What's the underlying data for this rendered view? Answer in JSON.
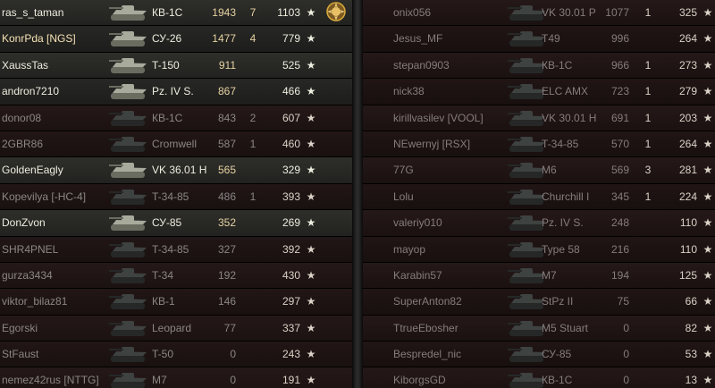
{
  "left_team": [
    {
      "player": "ras_s_taman",
      "tank": "КВ-1С",
      "damage": "1943",
      "kills": "7",
      "xp": "1103",
      "alive": true,
      "medal": true
    },
    {
      "player": "KonrPda [NGS]",
      "tank": "СУ-26",
      "damage": "1477",
      "kills": "4",
      "xp": "779",
      "alive": true,
      "me": true
    },
    {
      "player": "XaussTas",
      "tank": "T-150",
      "damage": "911",
      "kills": "",
      "xp": "525",
      "alive": true
    },
    {
      "player": "andron7210",
      "tank": "Pz. IV S.",
      "damage": "867",
      "kills": "",
      "xp": "466",
      "alive": true
    },
    {
      "player": "donor08",
      "tank": "КВ-1С",
      "damage": "843",
      "kills": "2",
      "xp": "607",
      "alive": false
    },
    {
      "player": "2GBR86",
      "tank": "Cromwell",
      "damage": "587",
      "kills": "1",
      "xp": "460",
      "alive": false
    },
    {
      "player": "GoldenEagly",
      "tank": "VK 36.01 H",
      "damage": "565",
      "kills": "",
      "xp": "329",
      "alive": true
    },
    {
      "player": "Kopevilya [-HC-4]",
      "tank": "T-34-85",
      "damage": "486",
      "kills": "1",
      "xp": "393",
      "alive": false
    },
    {
      "player": "DonZvon",
      "tank": "СУ-85",
      "damage": "352",
      "kills": "",
      "xp": "269",
      "alive": true
    },
    {
      "player": "SHR4PNEL",
      "tank": "T-34-85",
      "damage": "327",
      "kills": "",
      "xp": "392",
      "alive": false
    },
    {
      "player": "gurza3434",
      "tank": "T-34",
      "damage": "192",
      "kills": "",
      "xp": "430",
      "alive": false
    },
    {
      "player": "viktor_bilaz81",
      "tank": "КВ-1",
      "damage": "146",
      "kills": "",
      "xp": "297",
      "alive": false
    },
    {
      "player": "Egorski",
      "tank": "Leopard",
      "damage": "77",
      "kills": "",
      "xp": "337",
      "alive": false
    },
    {
      "player": "StFaust",
      "tank": "T-50",
      "damage": "0",
      "kills": "",
      "xp": "243",
      "alive": false
    },
    {
      "player": "nemez42rus [NTTG]",
      "tank": "M7",
      "damage": "0",
      "kills": "",
      "xp": "191",
      "alive": false
    }
  ],
  "right_team": [
    {
      "player": "onix056",
      "tank": "VK 30.01 P",
      "damage": "1077",
      "kills": "1",
      "xp": "325"
    },
    {
      "player": "Jesus_MF",
      "tank": "T49",
      "damage": "996",
      "kills": "",
      "xp": "264"
    },
    {
      "player": "stepan0903",
      "tank": "КВ-1С",
      "damage": "966",
      "kills": "1",
      "xp": "273"
    },
    {
      "player": "nick38",
      "tank": "ELC AMX",
      "damage": "723",
      "kills": "1",
      "xp": "279"
    },
    {
      "player": "kirillvasilev [VOOL]",
      "tank": "VK 30.01 H",
      "damage": "691",
      "kills": "1",
      "xp": "203"
    },
    {
      "player": "NEwernyj [RSX]",
      "tank": "T-34-85",
      "damage": "570",
      "kills": "1",
      "xp": "264"
    },
    {
      "player": "77G",
      "tank": "M6",
      "damage": "569",
      "kills": "3",
      "xp": "281"
    },
    {
      "player": "Lolu",
      "tank": "Churchill I",
      "damage": "345",
      "kills": "1",
      "xp": "224"
    },
    {
      "player": "valeriy010",
      "tank": "Pz. IV S.",
      "damage": "248",
      "kills": "",
      "xp": "110"
    },
    {
      "player": "mayop",
      "tank": "Type 58",
      "damage": "216",
      "kills": "",
      "xp": "110"
    },
    {
      "player": "Karabin57",
      "tank": "M7",
      "damage": "194",
      "kills": "",
      "xp": "125"
    },
    {
      "player": "SuperAnton82",
      "tank": "StPz II",
      "damage": "75",
      "kills": "",
      "xp": "66"
    },
    {
      "player": "TtrueEbosher",
      "tank": "M5 Stuart",
      "damage": "0",
      "kills": "",
      "xp": "82"
    },
    {
      "player": "Bespredel_nic",
      "tank": "СУ-85",
      "damage": "0",
      "kills": "",
      "xp": "53"
    },
    {
      "player": "KiborgsGD",
      "tank": "КВ-1С",
      "damage": "0",
      "kills": "",
      "xp": "13"
    }
  ],
  "icons": {
    "xp_star": "★",
    "tank_icon": "tank-silhouette-icon",
    "medal_icon": "medal-icon"
  },
  "colors": {
    "alive_text": "#ededdf",
    "dead_text": "#8b8686",
    "damage_text": "#e7d3a2",
    "highlight_row": "#4a3a22",
    "dead_row": "#251818"
  }
}
